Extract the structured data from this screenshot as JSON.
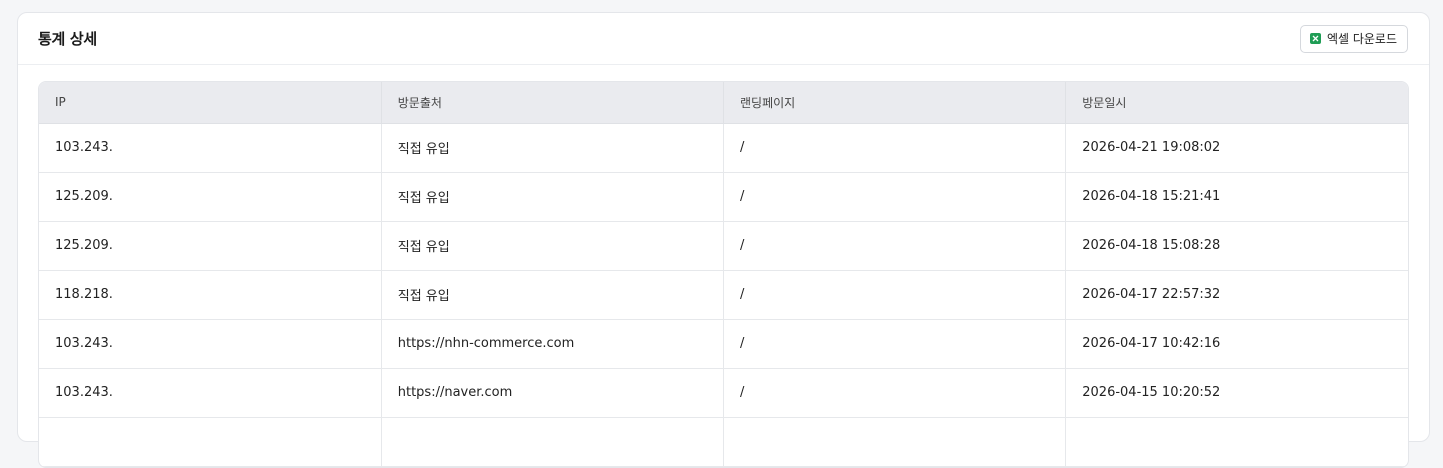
{
  "card": {
    "title": "통계 상세",
    "excel_button_label": "엑셀 다운로드",
    "excel_icon": "excel-file-icon",
    "accent_color": "#1f9d55"
  },
  "table": {
    "columns": [
      "IP",
      "방문출처",
      "랜딩페이지",
      "방문일시"
    ],
    "rows": [
      [
        "103.243.",
        "직접 유입",
        "/",
        "2026-04-21 19:08:02"
      ],
      [
        "125.209.",
        "직접 유입",
        "/",
        "2026-04-18 15:21:41"
      ],
      [
        "125.209.",
        "직접 유입",
        "/",
        "2026-04-18 15:08:28"
      ],
      [
        "118.218.",
        "직접 유입",
        "/",
        "2026-04-17 22:57:32"
      ],
      [
        "103.243.",
        "https://nhn-commerce.com",
        "/",
        "2026-04-17 10:42:16"
      ],
      [
        "103.243.",
        "https://naver.com",
        "/",
        "2026-04-15 10:20:52"
      ],
      [
        "",
        "",
        "",
        ""
      ]
    ]
  }
}
